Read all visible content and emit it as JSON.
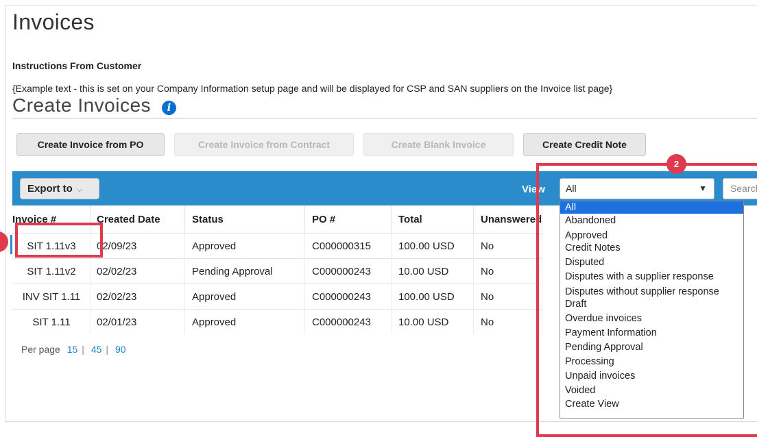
{
  "page": {
    "title": "Invoices"
  },
  "instructions": {
    "heading": "Instructions From Customer",
    "text": "{Example text - this is set on your Company Information setup page and will be displayed for CSP and SAN suppliers on the Invoice list page}"
  },
  "section": {
    "title": "Create Invoices"
  },
  "actions": {
    "create_from_po": "Create Invoice from PO",
    "create_from_contract": "Create Invoice from Contract",
    "create_blank": "Create Blank Invoice",
    "create_credit_note": "Create Credit Note"
  },
  "toolbar": {
    "export_label": "Export to",
    "view_label": "View",
    "view_selected": "All",
    "search_placeholder": "Search"
  },
  "table": {
    "columns": [
      "Invoice #",
      "Created Date",
      "Status",
      "PO #",
      "Total",
      "Unanswered"
    ],
    "rows": [
      {
        "invoice": "SIT 1.11v3",
        "date": "02/09/23",
        "status": "Approved",
        "po": "C000000315",
        "total": "100.00 USD",
        "unanswered": "No"
      },
      {
        "invoice": "SIT 1.11v2",
        "date": "02/02/23",
        "status": "Pending Approval",
        "po": "C000000243",
        "total": "10.00 USD",
        "unanswered": "No"
      },
      {
        "invoice": "INV SIT 1.11",
        "date": "02/02/23",
        "status": "Approved",
        "po": "C000000243",
        "total": "100.00 USD",
        "unanswered": "No"
      },
      {
        "invoice": "SIT 1.11",
        "date": "02/01/23",
        "status": "Approved",
        "po": "C000000243",
        "total": "10.00 USD",
        "unanswered": "No"
      }
    ]
  },
  "pagination": {
    "label": "Per page",
    "options": [
      "15",
      "45",
      "90"
    ]
  },
  "view_options": [
    "All",
    "Abandoned",
    "Approved",
    "Credit Notes",
    "Disputed",
    "Disputes with a supplier response",
    "Disputes without supplier response",
    "Draft",
    "Overdue invoices",
    "Payment Information",
    "Pending Approval",
    "Processing",
    "Unpaid invoices",
    "Voided",
    "Create View"
  ],
  "annotations": {
    "badge_2": "2"
  },
  "colors": {
    "toolbar": "#2b8ccc",
    "link": "#1a83d6",
    "highlight": "#e03a4e",
    "selected": "#1e70e0"
  }
}
